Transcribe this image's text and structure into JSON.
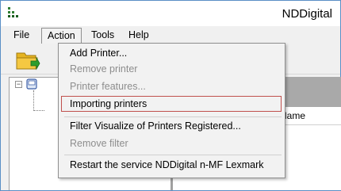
{
  "window": {
    "title": "NDDigital",
    "icon": "app-grid-icon"
  },
  "menubar": {
    "items": [
      {
        "label": "File"
      },
      {
        "label": "Action"
      },
      {
        "label": "Tools"
      },
      {
        "label": "Help"
      }
    ]
  },
  "toolbar": {
    "icons": [
      "folder-import-icon"
    ]
  },
  "grid": {
    "columns": [
      {
        "label": "Name"
      }
    ]
  },
  "action_menu": {
    "items": [
      {
        "label": "Add Printer...",
        "enabled": true
      },
      {
        "label": "Remove printer",
        "enabled": false
      },
      {
        "label": "Printer features...",
        "enabled": false
      },
      {
        "label": "Importing printers",
        "enabled": true,
        "highlighted": true
      },
      {
        "label": "Filter Visualize of Printers Registered...",
        "enabled": true
      },
      {
        "label": "Remove filter",
        "enabled": false
      },
      {
        "label": "Restart the service NDDigital n-MF Lexmark",
        "enabled": true
      }
    ]
  },
  "colors": {
    "highlight_border": "#c0504d",
    "disabled_text": "#8d8d8d",
    "window_border": "#5a8fc6"
  }
}
